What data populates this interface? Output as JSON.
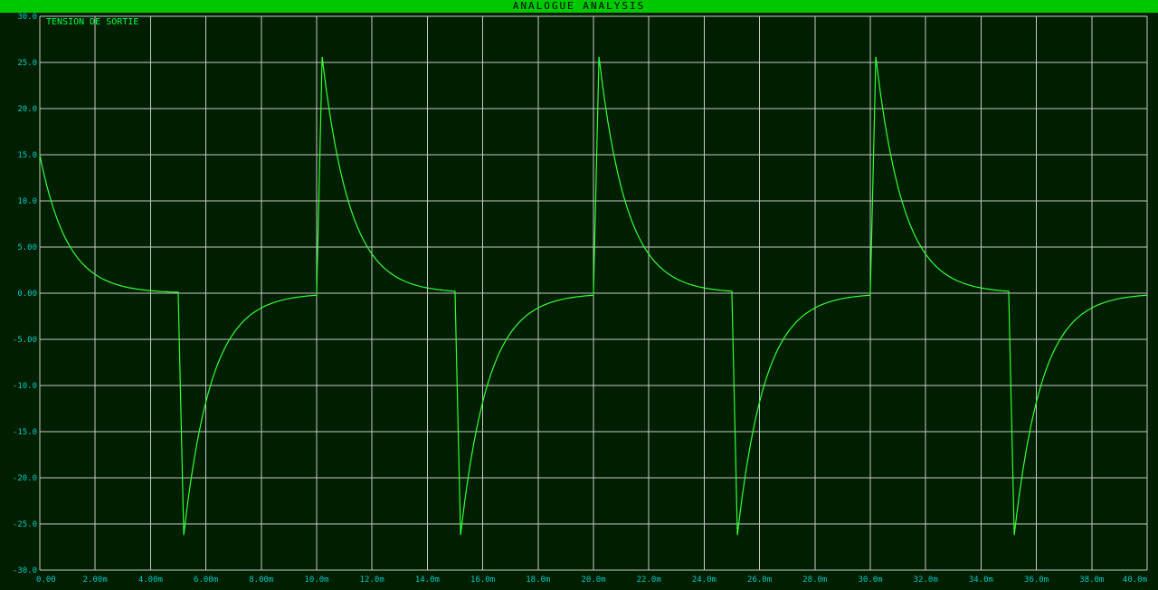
{
  "window": {
    "title": "ANALOGUE ANALYSIS"
  },
  "chart_data": {
    "type": "line",
    "title": "ANALOGUE ANALYSIS",
    "series": [
      {
        "name": "TENSION  DE SORTIE",
        "color": "#33ff33"
      }
    ],
    "xlim": [
      0,
      40
    ],
    "ylim": [
      -30,
      30
    ],
    "x_ticks": [
      0,
      2,
      4,
      6,
      8,
      10,
      12,
      14,
      16,
      18,
      20,
      22,
      24,
      26,
      28,
      30,
      32,
      34,
      36,
      38,
      40
    ],
    "x_tick_labels": [
      "0.00",
      "2.00m",
      "4.00m",
      "6.00m",
      "8.00m",
      "10.0m",
      "12.0m",
      "14.0m",
      "16.0m",
      "18.0m",
      "20.0m",
      "22.0m",
      "24.0m",
      "26.0m",
      "28.0m",
      "30.0m",
      "32.0m",
      "34.0m",
      "36.0m",
      "38.0m",
      "40.0m"
    ],
    "y_ticks": [
      30,
      25,
      20,
      15,
      10,
      5,
      0,
      -5,
      -10,
      -15,
      -20,
      -25,
      -30
    ],
    "y_tick_labels": [
      "30.0",
      "25.0",
      "20.0",
      "15.0",
      "10.0",
      "5.00",
      "0.00",
      "-5.00",
      "-10.0",
      "-15.0",
      "-20.0",
      "-25.0",
      "-30.0"
    ],
    "grid": true,
    "waveform": {
      "description_units": "x in ms, y in V",
      "segments": [
        {
          "x_start": 0,
          "x_end": 5,
          "peak": 15,
          "tau": 1.0
        },
        {
          "x_start": 5,
          "x_end": 5.2,
          "peak": 0,
          "edge_to": -26.2
        },
        {
          "x_start": 5.2,
          "x_end": 10,
          "peak": -26.2,
          "tau": 1.0
        },
        {
          "x_start": 10,
          "x_end": 10.2,
          "peak": 0,
          "edge_to": 25.6
        },
        {
          "x_start": 10.2,
          "x_end": 15,
          "peak": 25.6,
          "tau": 1.0
        },
        {
          "x_start": 15,
          "x_end": 15.2,
          "peak": 0,
          "edge_to": -26.2
        },
        {
          "x_start": 15.2,
          "x_end": 20,
          "peak": -26.2,
          "tau": 1.0
        },
        {
          "x_start": 20,
          "x_end": 20.2,
          "peak": 0,
          "edge_to": 25.6
        },
        {
          "x_start": 20.2,
          "x_end": 25,
          "peak": 25.6,
          "tau": 1.0
        },
        {
          "x_start": 25,
          "x_end": 25.2,
          "peak": 0,
          "edge_to": -26.2
        },
        {
          "x_start": 25.2,
          "x_end": 30,
          "peak": -26.2,
          "tau": 1.0
        },
        {
          "x_start": 30,
          "x_end": 30.2,
          "peak": 0,
          "edge_to": 25.6
        },
        {
          "x_start": 30.2,
          "x_end": 35,
          "peak": 25.6,
          "tau": 1.0
        },
        {
          "x_start": 35,
          "x_end": 35.2,
          "peak": 0,
          "edge_to": -26.2
        },
        {
          "x_start": 35.2,
          "x_end": 40,
          "peak": -26.2,
          "tau": 1.0
        }
      ]
    }
  }
}
